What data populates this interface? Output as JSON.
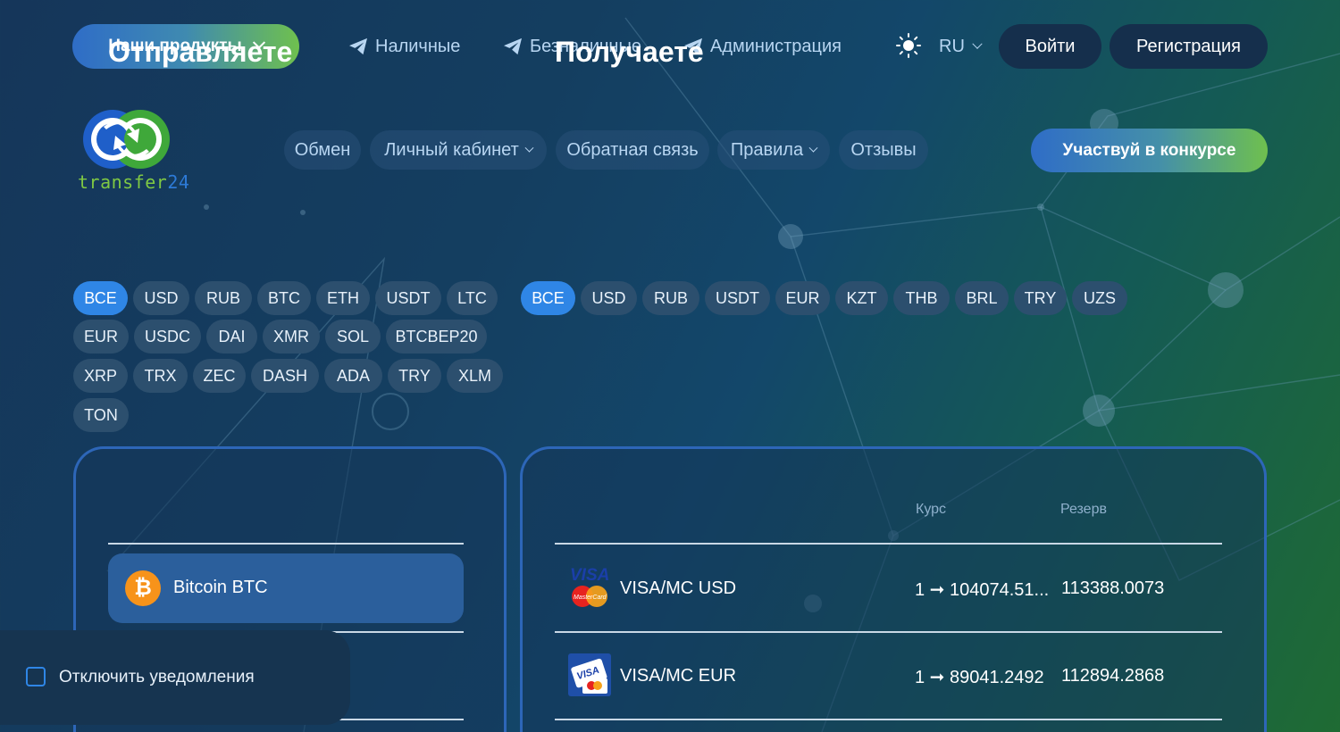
{
  "topbar": {
    "products_label": "Наши продукты",
    "links": [
      "Наличные",
      "Безналичные",
      "Администрация"
    ],
    "lang": "RU",
    "login_label": "Войти",
    "register_label": "Регистрация"
  },
  "logo": {
    "text_a": "transfer",
    "text_b": "24"
  },
  "nav": {
    "items": [
      "Обмен",
      "Личный кабинет",
      "Обратная связь",
      "Правила",
      "Отзывы"
    ],
    "contest_label": "Участвуй в конкурсе"
  },
  "send_filters": {
    "row1": [
      "ВСЕ",
      "USD",
      "RUB",
      "BTC",
      "ETH",
      "USDT",
      "LTC"
    ],
    "row2": [
      "EUR",
      "USDC",
      "DAI",
      "XMR",
      "SOL",
      "BTCBEP20"
    ],
    "row3": [
      "XRP",
      "TRX",
      "ZEC",
      "DASH",
      "ADA",
      "TRY",
      "XLM"
    ],
    "row4": [
      "TON"
    ]
  },
  "recv_filters": [
    "ВСЕ",
    "USD",
    "RUB",
    "USDT",
    "EUR",
    "KZT",
    "THB",
    "BRL",
    "TRY",
    "UZS"
  ],
  "send_panel": {
    "title": "Отправляете",
    "selected": {
      "name": "Bitcoin BTC",
      "icon": "bitcoin-icon",
      "color": "#f7931a"
    }
  },
  "recv_panel": {
    "title": "Получаете",
    "rate_header": "Курс",
    "reserve_header": "Резерв",
    "rows": [
      {
        "name": "VISA/MC USD",
        "rate": "1 ➞ 104074.51...",
        "reserve": "113388.0073",
        "icon": "visa-mastercard-icon"
      },
      {
        "name": "VISA/MC EUR",
        "rate": "1 ➞ 89041.2492",
        "reserve": "112894.2868",
        "icon": "visa-card-icon"
      }
    ]
  },
  "notifications": {
    "label": "Отключить уведомления",
    "checked": false
  },
  "colors": {
    "accent": "#2f86e6",
    "chip": "#2c4f6e",
    "green": "#6fc04e",
    "bitcoin": "#f7931a"
  }
}
